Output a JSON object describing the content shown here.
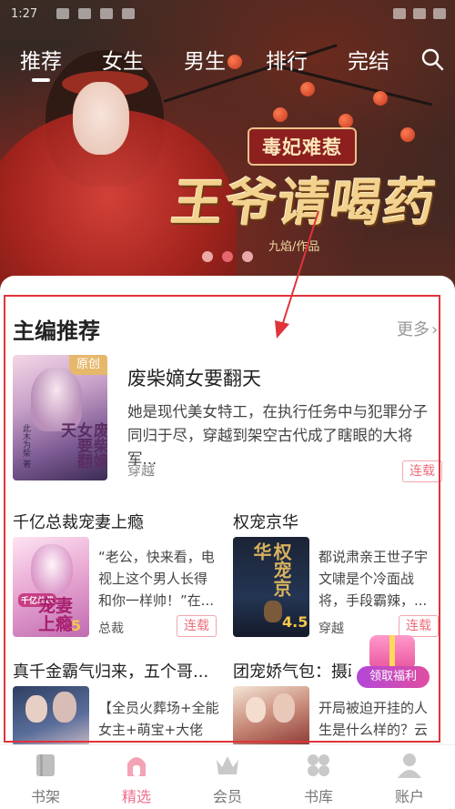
{
  "status_bar": {
    "time": "1:27"
  },
  "top_nav": {
    "tabs": [
      {
        "label": "推荐",
        "active": true
      },
      {
        "label": "女生",
        "active": false
      },
      {
        "label": "男生",
        "active": false
      },
      {
        "label": "排行",
        "active": false
      },
      {
        "label": "完结",
        "active": false
      }
    ],
    "search_icon": "search-icon"
  },
  "banner": {
    "tagline": "毒妃难惹",
    "title": "王爷请喝药",
    "author": "九焰/作品",
    "slides": 3,
    "active_slide": 2
  },
  "section": {
    "title": "主编推荐",
    "more": "更多",
    "featured": {
      "title": "废柴嫡女要翻天",
      "badge": "原创",
      "cover_text": "废柴嫡女要翻天",
      "cover_author": "此木为柴 著",
      "description": "她是现代美女特工，在执行任务中与犯罪分子同归于尽，穿越到架空古代成了瞎眼的大将军...",
      "author": "穿越",
      "status": "连载"
    },
    "grid": [
      {
        "title": "千亿总裁宠妻上瘾",
        "cover_text": "宠妻上瘾",
        "cover_sub": "千亿总裁",
        "score": "5",
        "description": "“老公，快来看，电视上这个男人长得和你一样帅！”在...",
        "author": "总裁",
        "status": "连载"
      },
      {
        "title": "权宠京华",
        "cover_text": "权宠京华",
        "score": "4.5",
        "description": "都说肃亲王世子宇文啸是个冷面战将，手段霸辣，...",
        "author": "穿越",
        "status": "连载"
      },
      {
        "title": "真千金霸气归来，五个哥...",
        "description": "【全员火葬场+全能女主+萌宝+大佬"
      },
      {
        "title": "团宠娇气包：摄政",
        "description": "开局被迫开挂的人生是什么样的？云"
      }
    ]
  },
  "welfare": {
    "label": "领取福利"
  },
  "bottom_nav": [
    {
      "label": "书架",
      "icon": "bookshelf-icon",
      "active": false
    },
    {
      "label": "精选",
      "icon": "featured-icon",
      "active": true
    },
    {
      "label": "会员",
      "icon": "crown-icon",
      "active": false
    },
    {
      "label": "书库",
      "icon": "library-icon",
      "active": false
    },
    {
      "label": "账户",
      "icon": "account-icon",
      "active": false
    }
  ],
  "colors": {
    "accent": "#f06e8a",
    "highlight_box": "#e0333a",
    "tag_border": "#f3a5ae"
  }
}
